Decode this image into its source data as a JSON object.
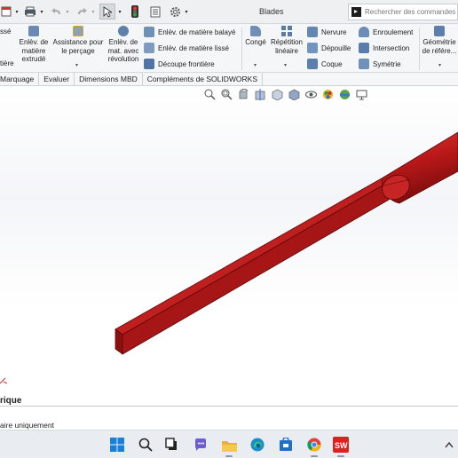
{
  "titlebar": {
    "doc_title": "Blades",
    "search_placeholder": "Rechercher des commandes"
  },
  "ribbon": {
    "left_cut_top": "ssé",
    "left_cut_bottom": "tière",
    "extrude_cut": [
      "Enlèv. de",
      "matière",
      "extrudé"
    ],
    "hole_wizard": [
      "Assistance pour",
      "le perçage"
    ],
    "revolve_cut": [
      "Enlèv. de",
      "mat. avec",
      "révolution"
    ],
    "swept_cut": "Enlèv. de matière balayé",
    "lofted_cut": "Enlèv. de matière lissé",
    "boundary_cut": "Découpe frontière",
    "fillet": "Congé",
    "linear_pattern": [
      "Répétition",
      "linéaire"
    ],
    "rib": "Nervure",
    "draft": "Dépouille",
    "shell": "Coque",
    "wrap": "Enroulement",
    "intersect": "Intersection",
    "mirror": "Symétrie",
    "ref_geometry": [
      "Géométrie",
      "de référe..."
    ]
  },
  "tabs": [
    "Marquage",
    "Evaluer",
    "Dimensions MBD",
    "Compléments de SOLIDWORKS"
  ],
  "viewport": {
    "feature_label": "rique",
    "part_colors": {
      "blade": "#c41e1e",
      "blade_dark": "#8d1010",
      "handle": "#c41e1e"
    }
  },
  "statusbar": {
    "text": "aire uniquement"
  },
  "taskbar": {
    "icons": [
      "windows-start-icon",
      "search-icon",
      "task-view-icon",
      "teams-chat-icon",
      "file-explorer-icon",
      "edge-icon",
      "store-icon",
      "chrome-icon",
      "solidworks-icon"
    ]
  },
  "colors": {
    "accent": "#1a63c7",
    "ribbon_bg": "#f5f6f7",
    "taskbar_bg": "#e9edf2"
  }
}
